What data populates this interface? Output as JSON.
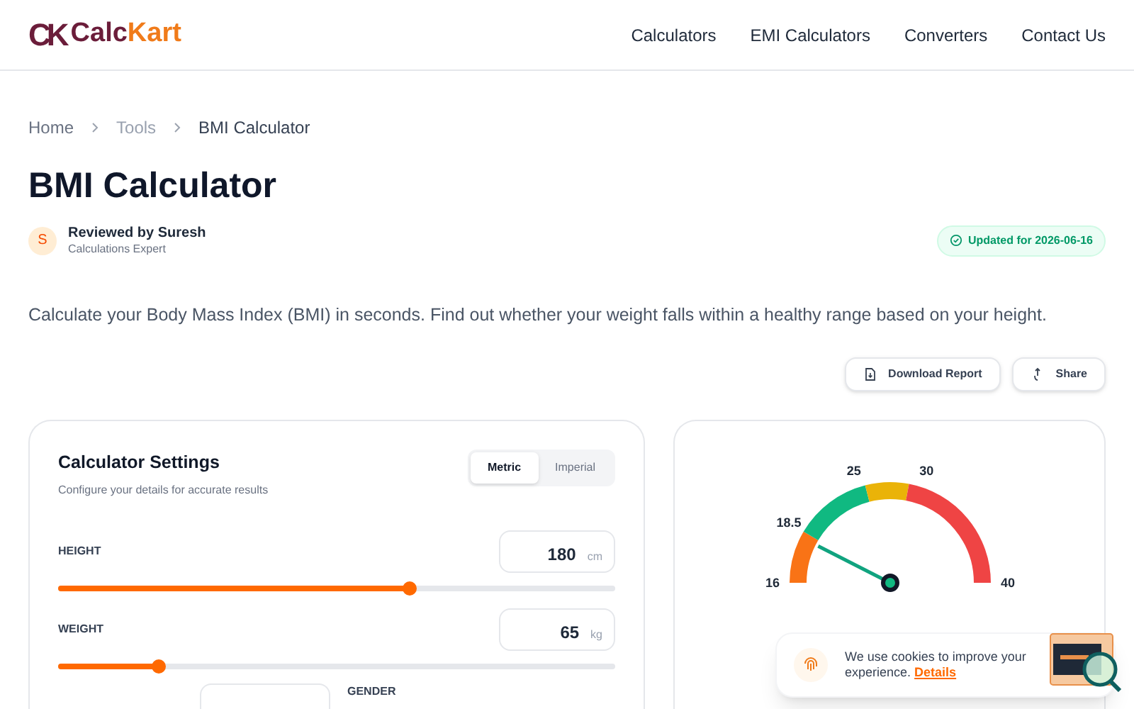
{
  "brand": {
    "mark": "CK",
    "name_first": "Calc",
    "name_second": "Kart"
  },
  "nav": [
    "Calculators",
    "EMI Calculators",
    "Converters",
    "Contact Us"
  ],
  "breadcrumb": [
    {
      "label": "Home",
      "current": false
    },
    {
      "label": "Tools",
      "current": false
    },
    {
      "label": "BMI Calculator",
      "current": true
    }
  ],
  "title": "BMI Calculator",
  "reviewer": {
    "initial": "S",
    "name": "Reviewed by Suresh",
    "role": "Calculations Expert"
  },
  "updated_badge": "Updated for 2026-06-16",
  "description": "Calculate your Body Mass Index (BMI) in seconds. Find out whether your weight falls within a healthy range based on your height.",
  "actions": [
    "Download Report",
    "Share"
  ],
  "settings": {
    "title": "Calculator Settings",
    "subtitle": "Configure your details for accurate results",
    "units": [
      {
        "label": "Metric",
        "selected": true
      },
      {
        "label": "Imperial",
        "selected": false
      }
    ],
    "sliders": [
      {
        "label": "HEIGHT",
        "value": "180",
        "unit": "cm",
        "level": 0.63
      },
      {
        "label": "WEIGHT",
        "value": "65",
        "unit": "kg",
        "level": 0.18
      }
    ],
    "gender_label": "GENDER"
  },
  "gauge": {
    "ticks": [
      "16",
      "18.5",
      "25",
      "30",
      "40"
    ]
  },
  "cookie": {
    "text": "We use cookies to improve your experience.",
    "link": "Details"
  }
}
